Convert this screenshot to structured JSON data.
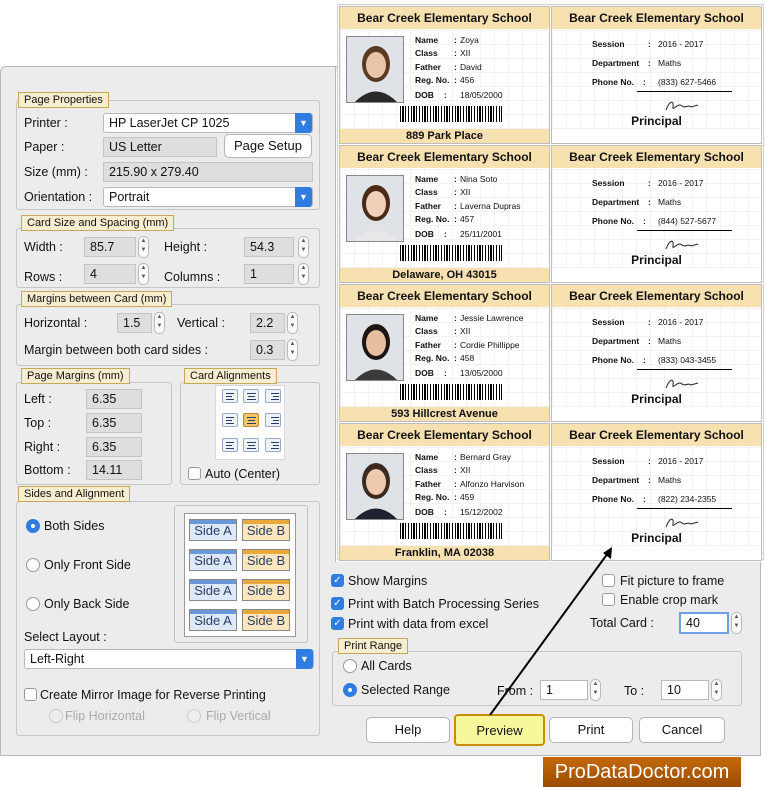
{
  "page_properties": {
    "legend": "Page Properties",
    "printer_label": "Printer :",
    "printer_value": "HP LaserJet CP 1025",
    "paper_label": "Paper :",
    "paper_value": "US Letter",
    "page_setup_button": "Page Setup",
    "size_label": "Size (mm) :",
    "size_value": "215.90 x 279.40",
    "orientation_label": "Orientation :",
    "orientation_value": "Portrait"
  },
  "card_size": {
    "legend": "Card Size and Spacing (mm)",
    "width_label": "Width :",
    "width_value": "85.7",
    "height_label": "Height :",
    "height_value": "54.3",
    "rows_label": "Rows :",
    "rows_value": "4",
    "columns_label": "Columns :",
    "columns_value": "1"
  },
  "margins_card": {
    "legend": "Margins between Card (mm)",
    "horizontal_label": "Horizontal :",
    "horizontal_value": "1.5",
    "vertical_label": "Vertical :",
    "vertical_value": "2.2",
    "both_sides_label": "Margin between both card sides :",
    "both_sides_value": "0.3"
  },
  "page_margins": {
    "legend": "Page Margins (mm)",
    "left_label": "Left :",
    "left_value": "6.35",
    "top_label": "Top :",
    "top_value": "6.35",
    "right_label": "Right :",
    "right_value": "6.35",
    "bottom_label": "Bottom :",
    "bottom_value": "14.11"
  },
  "card_alignments": {
    "legend": "Card Alignments",
    "auto_center_label": "Auto (Center)",
    "selected": "middle-center"
  },
  "sides": {
    "legend": "Sides and Alignment",
    "both_sides": "Both Sides",
    "only_front": "Only Front Side",
    "only_back": "Only Back Side",
    "select_layout_label": "Select Layout :",
    "layout_value": "Left-Right",
    "side_a": "Side A",
    "side_b": "Side B",
    "mirror_label": "Create Mirror Image for Reverse Printing",
    "flip_horizontal": "Flip Horizontal",
    "flip_vertical": "Flip Vertical"
  },
  "options": {
    "show_margins": "Show Margins",
    "batch_series": "Print with Batch Processing Series",
    "data_excel": "Print with data from excel",
    "fit_picture": "Fit picture to frame",
    "crop_mark": "Enable crop mark",
    "total_card_label": "Total Card :",
    "total_card_value": "40"
  },
  "print_range": {
    "legend": "Print Range",
    "all_cards": "All Cards",
    "selected_range": "Selected Range",
    "from_label": "From :",
    "from_value": "1",
    "to_label": "To :",
    "to_value": "10"
  },
  "buttons": {
    "help": "Help",
    "preview": "Preview",
    "print": "Print",
    "cancel": "Cancel"
  },
  "brand": "ProDataDoctor.com",
  "card_labels": {
    "school": "Bear Creek Elementary School",
    "name": "Name",
    "class": "Class",
    "father": "Father",
    "reg_no": "Reg. No.",
    "dob": "DOB",
    "session": "Session",
    "department": "Department",
    "phone": "Phone No.",
    "principal": "Principal"
  },
  "cards": [
    {
      "name": "Zoya",
      "class": "XII",
      "father": "David",
      "reg_no": "456",
      "dob": "18/05/2000",
      "address": "889 Park Place",
      "session": "2016 - 2017",
      "department": "Maths",
      "phone": "(833) 627-5466"
    },
    {
      "name": "Nina Soto",
      "class": "XII",
      "father": "Laverna Dupras",
      "reg_no": "457",
      "dob": "25/11/2001",
      "address": "Delaware, OH 43015",
      "session": "2016 - 2017",
      "department": "Maths",
      "phone": "(844) 527-5677"
    },
    {
      "name": "Jessie Lawrence",
      "class": "XII",
      "father": "Cordie Phillippe",
      "reg_no": "458",
      "dob": "13/05/2000",
      "address": "593 Hillcrest Avenue",
      "session": "2016 - 2017",
      "department": "Maths",
      "phone": "(833) 043-3455"
    },
    {
      "name": "Bernard Gray",
      "class": "XII",
      "father": "Alfonzo Harvison",
      "reg_no": "459",
      "dob": "15/12/2002",
      "address": "Franklin, MA 02038",
      "session": "2016 - 2017",
      "department": "Maths",
      "phone": "(822) 234-2355"
    }
  ]
}
